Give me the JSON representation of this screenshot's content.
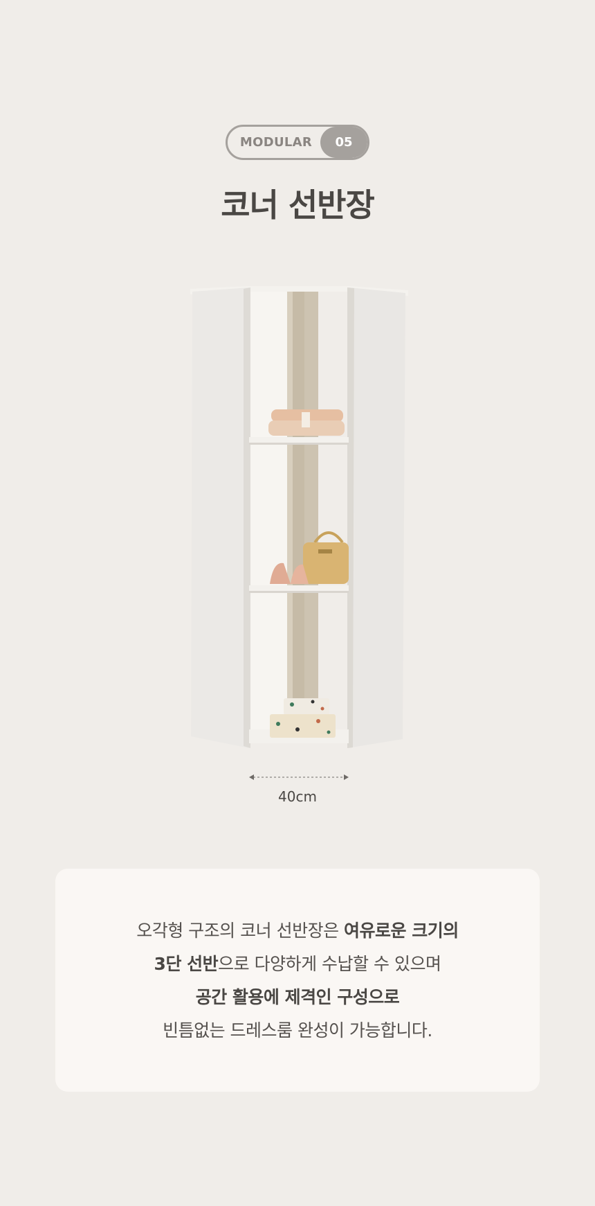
{
  "badge": {
    "label": "MODULAR",
    "number": "05"
  },
  "title": "코너 선반장",
  "dimension": {
    "width_label": "40cm"
  },
  "description": {
    "line1_normal": "오각형 구조의 코너 선반장은 ",
    "line1_bold": "여유로운 크기의",
    "line2_bold": "3단 선반",
    "line2_normal": "으로 다양하게 수납할 수 있으며",
    "line3_bold": "공간 활용에 제격인 구성으로",
    "line4_normal": "빈틈없는 드레스룸 완성이 가능합니다."
  },
  "colors": {
    "background": "#f0ede9",
    "card": "#faf7f4",
    "badge_gray": "#a5a19d",
    "text": "#4a4744"
  }
}
